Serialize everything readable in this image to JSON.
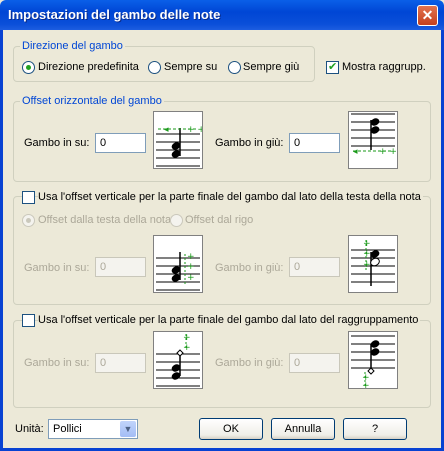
{
  "window": {
    "title": "Impostazioni del gambo delle note"
  },
  "direction": {
    "legend": "Direzione del gambo",
    "options": [
      "Direzione predefinita",
      "Sempre su",
      "Sempre giù"
    ],
    "selected": 0,
    "show_beaming_label": "Mostra raggrupp.",
    "show_beaming_checked": true
  },
  "horizontal": {
    "legend": "Offset orizzontale del gambo",
    "up_label": "Gambo in su:",
    "up_value": "0",
    "down_label": "Gambo in giù:",
    "down_value": "0"
  },
  "vertical_head": {
    "checkbox_label": "Usa l'offset verticale per la parte finale del gambo dal lato della testa della nota",
    "checked": false,
    "radio_options": [
      "Offset dalla testa della nota",
      "Offset dal rigo"
    ],
    "up_label": "Gambo in su:",
    "up_value": "0",
    "down_label": "Gambo in giù:",
    "down_value": "0"
  },
  "vertical_beam": {
    "checkbox_label": "Usa l'offset verticale per la parte finale del gambo dal lato del raggruppamento",
    "checked": false,
    "up_label": "Gambo in su:",
    "up_value": "0",
    "down_label": "Gambo in giù:",
    "down_value": "0"
  },
  "footer": {
    "units_label": "Unità:",
    "units_value": "Pollici",
    "ok_label": "OK",
    "cancel_label": "Annulla",
    "help_label": "?"
  },
  "colors": {
    "accent_title": "#0046d5",
    "guide_green": "#1a9a1a"
  }
}
